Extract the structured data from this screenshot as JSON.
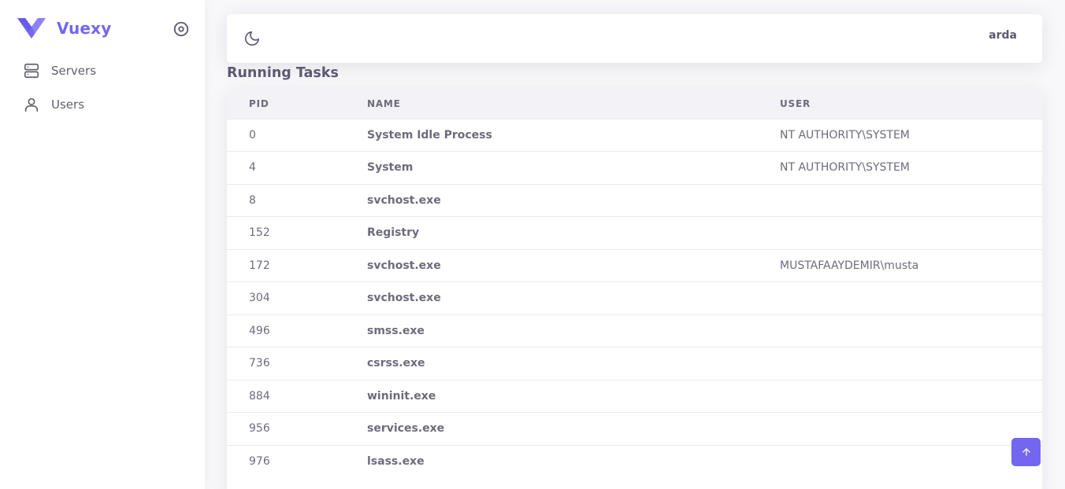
{
  "brand": {
    "name": "Vuexy",
    "accent": "#7367f0"
  },
  "sidebar": {
    "items": [
      {
        "label": "Servers",
        "icon": "server-icon"
      },
      {
        "label": "Users",
        "icon": "user-icon"
      }
    ]
  },
  "navbar": {
    "username": "arda",
    "theme_icon": "moon-icon"
  },
  "section": {
    "title": "Running Tasks"
  },
  "table": {
    "headers": [
      "PID",
      "NAME",
      "USER"
    ],
    "rows": [
      {
        "pid": "0",
        "name": "System Idle Process",
        "user": "NT AUTHORITY\\SYSTEM"
      },
      {
        "pid": "4",
        "name": "System",
        "user": "NT AUTHORITY\\SYSTEM"
      },
      {
        "pid": "8",
        "name": "svchost.exe",
        "user": ""
      },
      {
        "pid": "152",
        "name": "Registry",
        "user": ""
      },
      {
        "pid": "172",
        "name": "svchost.exe",
        "user": "MUSTAFAAYDEMIR\\musta"
      },
      {
        "pid": "304",
        "name": "svchost.exe",
        "user": ""
      },
      {
        "pid": "496",
        "name": "smss.exe",
        "user": ""
      },
      {
        "pid": "736",
        "name": "csrss.exe",
        "user": ""
      },
      {
        "pid": "884",
        "name": "wininit.exe",
        "user": ""
      },
      {
        "pid": "956",
        "name": "services.exe",
        "user": ""
      },
      {
        "pid": "976",
        "name": "lsass.exe",
        "user": ""
      }
    ]
  },
  "scroll_top": {
    "icon": "arrow-up-icon"
  }
}
